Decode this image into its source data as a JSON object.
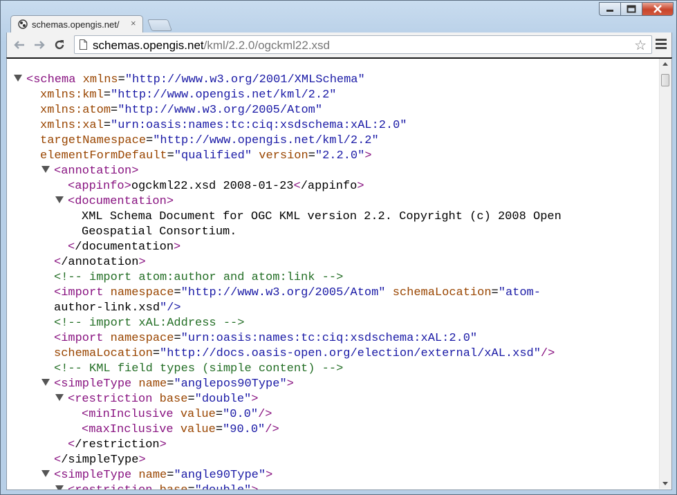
{
  "window": {
    "minimize_icon": "minimize-icon",
    "maximize_icon": "maximize-icon",
    "close_icon": "close-icon"
  },
  "tab": {
    "title": "schemas.opengis.net/",
    "close_label": "×"
  },
  "address_bar": {
    "host": "schemas.opengis.net",
    "path": "/kml/2.2.0/ogckml22.xsd"
  },
  "toolbar": {
    "back_icon": "back-arrow-icon",
    "forward_icon": "forward-arrow-icon",
    "reload_icon": "reload-icon",
    "star_label": "☆",
    "menu_icon": "hamburger-menu-icon"
  },
  "xml_lines": [
    "<schema xmlns=\"http://www.w3.org/2001/XMLSchema\"",
    "xmlns:kml=\"http://www.opengis.net/kml/2.2\"",
    "xmlns:atom=\"http://www.w3.org/2005/Atom\"",
    "xmlns:xal=\"urn:oasis:names:tc:ciq:xsdschema:xAL:2.0\"",
    "targetNamespace=\"http://www.opengis.net/kml/2.2\"",
    "elementFormDefault=\"qualified\" version=\"2.2.0\">",
    "<annotation>",
    "<appinfo>ogckml22.xsd 2008-01-23</appinfo>",
    "<documentation>",
    "XML Schema Document for OGC KML version 2.2. Copyright (c) 2008 Open",
    "Geospatial Consortium.",
    "</documentation>",
    "</annotation>",
    "<!-- import atom:author and atom:link -->",
    "<import namespace=\"http://www.w3.org/2005/Atom\" schemaLocation=\"atom-",
    "author-link.xsd\"/>",
    "<!-- import xAL:Address -->",
    "<import namespace=\"urn:oasis:names:tc:ciq:xsdschema:xAL:2.0\"",
    "schemaLocation=\"http://docs.oasis-open.org/election/external/xAL.xsd\"/>",
    "<!-- KML field types (simple content) -->",
    "<simpleType name=\"anglepos90Type\">",
    "<restriction base=\"double\">",
    "<minInclusive value=\"0.0\"/>",
    "<maxInclusive value=\"90.0\"/>",
    "</restriction>",
    "</simpleType>",
    "<simpleType name=\"angle90Type\">",
    "<restriction base=\"double\">"
  ],
  "colors": {
    "tag": "#881280",
    "attr_name": "#994500",
    "attr_value": "#1a1aa6",
    "comment": "#236e25",
    "text": "#000000"
  }
}
